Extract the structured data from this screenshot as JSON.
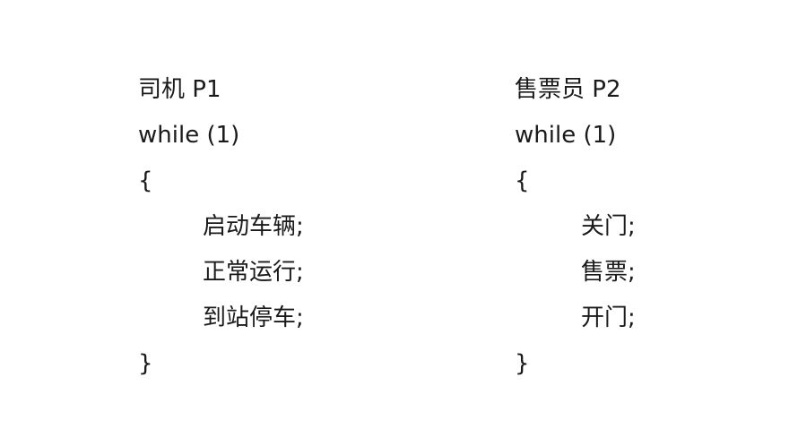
{
  "driver": {
    "header": "司机 P1",
    "loop": "while (1)",
    "open_brace": "{",
    "statements": [
      "启动车辆;",
      "正常运行;",
      "到站停车;"
    ],
    "close_brace": "}"
  },
  "conductor": {
    "header": "售票员 P2",
    "loop": "while (1)",
    "open_brace": "{",
    "statements": [
      "关门;",
      "售票;",
      "开门;"
    ],
    "close_brace": "}"
  }
}
